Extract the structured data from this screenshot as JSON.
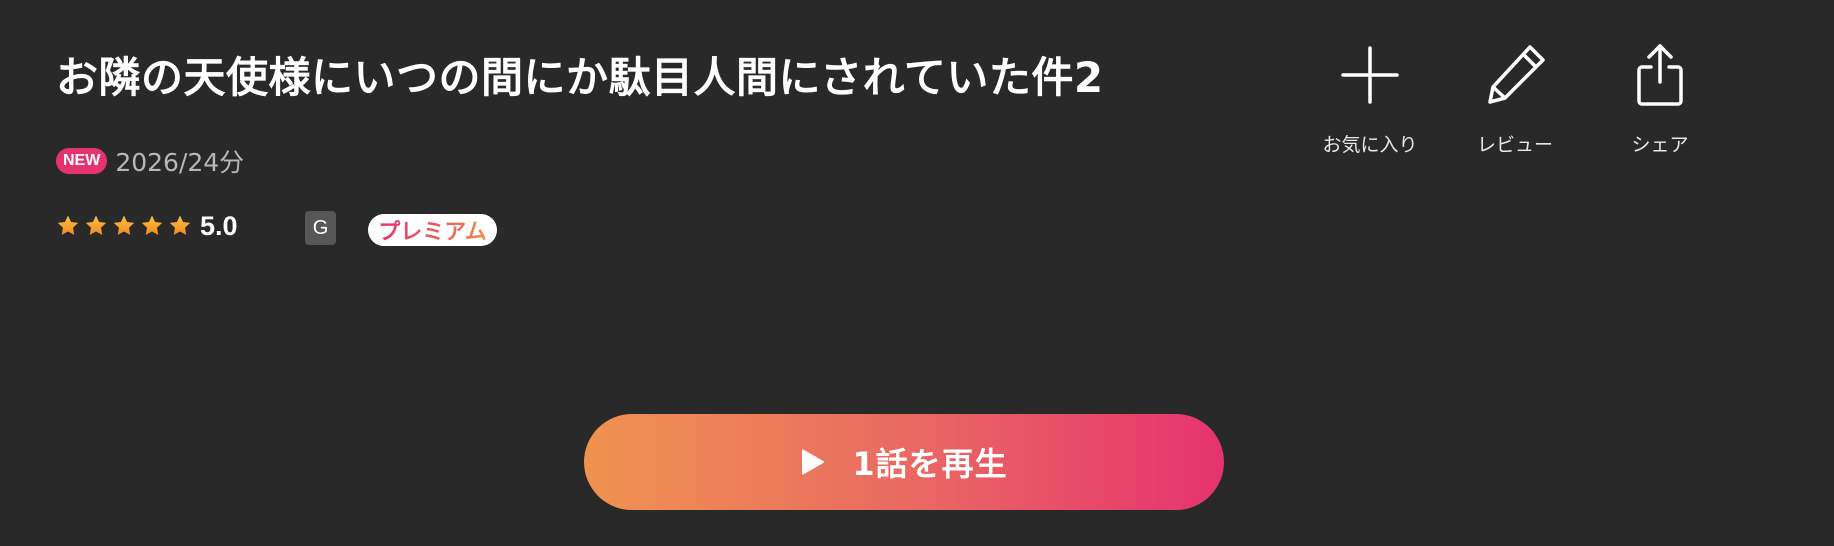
{
  "title": "お隣の天使様にいつの間にか駄目人間にされていた件2",
  "meta": {
    "new_badge": "NEW",
    "info": "2026/24分"
  },
  "rating": {
    "value": "5.0",
    "stars_filled": 5,
    "stars_total": 5
  },
  "age_rating": "G",
  "premium_label": "プレミアム",
  "actions": [
    {
      "label": "お気に入り",
      "icon": "plus-icon"
    },
    {
      "label": "レビュー",
      "icon": "pencil-icon"
    },
    {
      "label": "シェア",
      "icon": "share-icon"
    }
  ],
  "play_button": {
    "label": "1話を再生",
    "icon": "play-icon"
  },
  "colors": {
    "background": "#292929",
    "accent_pink": "#e5336f",
    "accent_orange": "#ef9350",
    "star": "#f5a623",
    "muted_text": "#b7b7b7"
  }
}
